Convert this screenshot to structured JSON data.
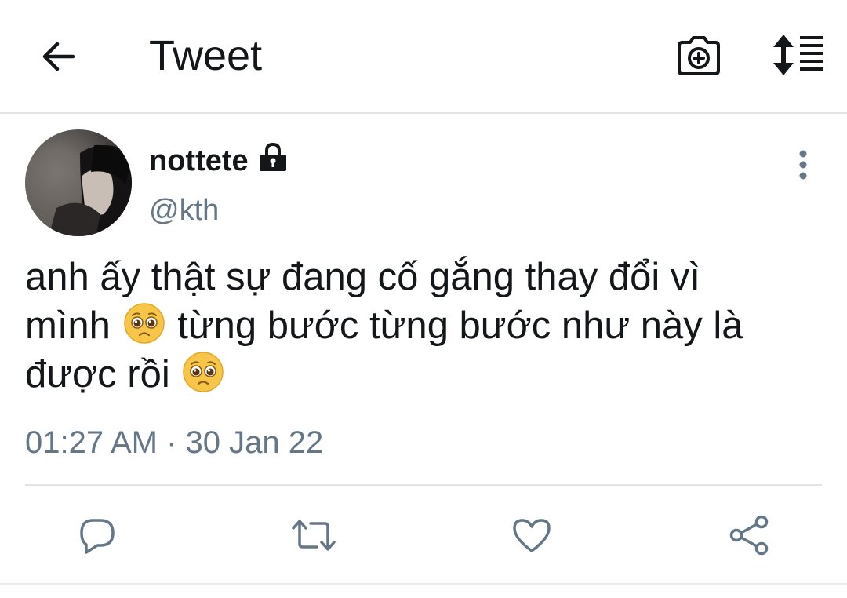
{
  "header": {
    "title": "Tweet",
    "back_icon": "arrow-left-icon",
    "camera_icon": "camera-plus-icon",
    "sort_icon": "sort-list-icon"
  },
  "tweet": {
    "display_name": "nottete",
    "handle": "@kth",
    "protected": true,
    "text_parts": {
      "line1": "anh ấy thật sự đang cố gắng thay đổi vì",
      "line2_before": "mình",
      "line2_after": "từng bước từng bước như này là",
      "line3_before": "được rồi"
    },
    "emoji_name": "pleading-face",
    "timestamp": "01:27 AM · 30 Jan 22"
  },
  "actions": [
    {
      "name": "reply",
      "icon": "reply-icon"
    },
    {
      "name": "retweet",
      "icon": "retweet-icon"
    },
    {
      "name": "like",
      "icon": "heart-icon"
    },
    {
      "name": "share",
      "icon": "share-icon"
    }
  ],
  "colors": {
    "text": "#14171a",
    "secondary": "#657786",
    "icon": "#657786",
    "divider": "#e1e4e6",
    "emoji_face": "#f7c548"
  }
}
